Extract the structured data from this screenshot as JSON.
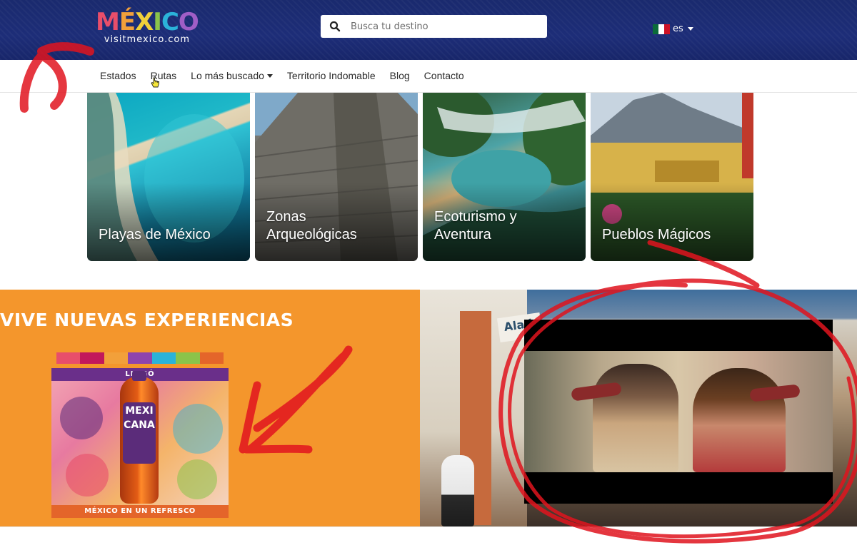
{
  "header": {
    "logo_text": "MÉXICO",
    "logo_letters": [
      "M",
      "É",
      "X",
      "I",
      "C",
      "O"
    ],
    "logo_colors": [
      "#e84e6a",
      "#f2a03a",
      "#f0d03a",
      "#8bc34a",
      "#2bb3d9",
      "#a05ec6"
    ],
    "logo_sub": "visitmexico.com",
    "search_placeholder": "Busca tu destino",
    "language": "es",
    "flag_colors": [
      "#0b6b3a",
      "#ffffff",
      "#ce1126"
    ]
  },
  "nav": {
    "items": [
      {
        "label": "Estados",
        "dropdown": false
      },
      {
        "label": "Rutas",
        "dropdown": false
      },
      {
        "label": "Lo más buscado",
        "dropdown": true
      },
      {
        "label": "Territorio Indomable",
        "dropdown": false
      },
      {
        "label": "Blog",
        "dropdown": false
      },
      {
        "label": "Contacto",
        "dropdown": false
      }
    ]
  },
  "categories": [
    {
      "line1": "Playas de México",
      "line2": ""
    },
    {
      "line1": "Zonas",
      "line2": "Arqueológicas"
    },
    {
      "line1": "Ecoturismo y",
      "line2": "Aventura"
    },
    {
      "line1": "Pueblos Mágicos",
      "line2": ""
    }
  ],
  "experiences": {
    "title": "VIVE NUEVAS EXPERIENCIAS",
    "poster_top": "LLEGÓ",
    "poster_bottle": "MEXICANA",
    "poster_bottom": "MÉXICO EN UN REFRESCO",
    "bar_colors": [
      "#e84e6a",
      "#c2185b",
      "#f2a03a",
      "#8e44ad",
      "#2bb3d9",
      "#8bc34a",
      "#e4652a"
    ]
  },
  "video": {
    "sign": "Alad"
  },
  "annotation": {
    "color": "#e0141e"
  }
}
